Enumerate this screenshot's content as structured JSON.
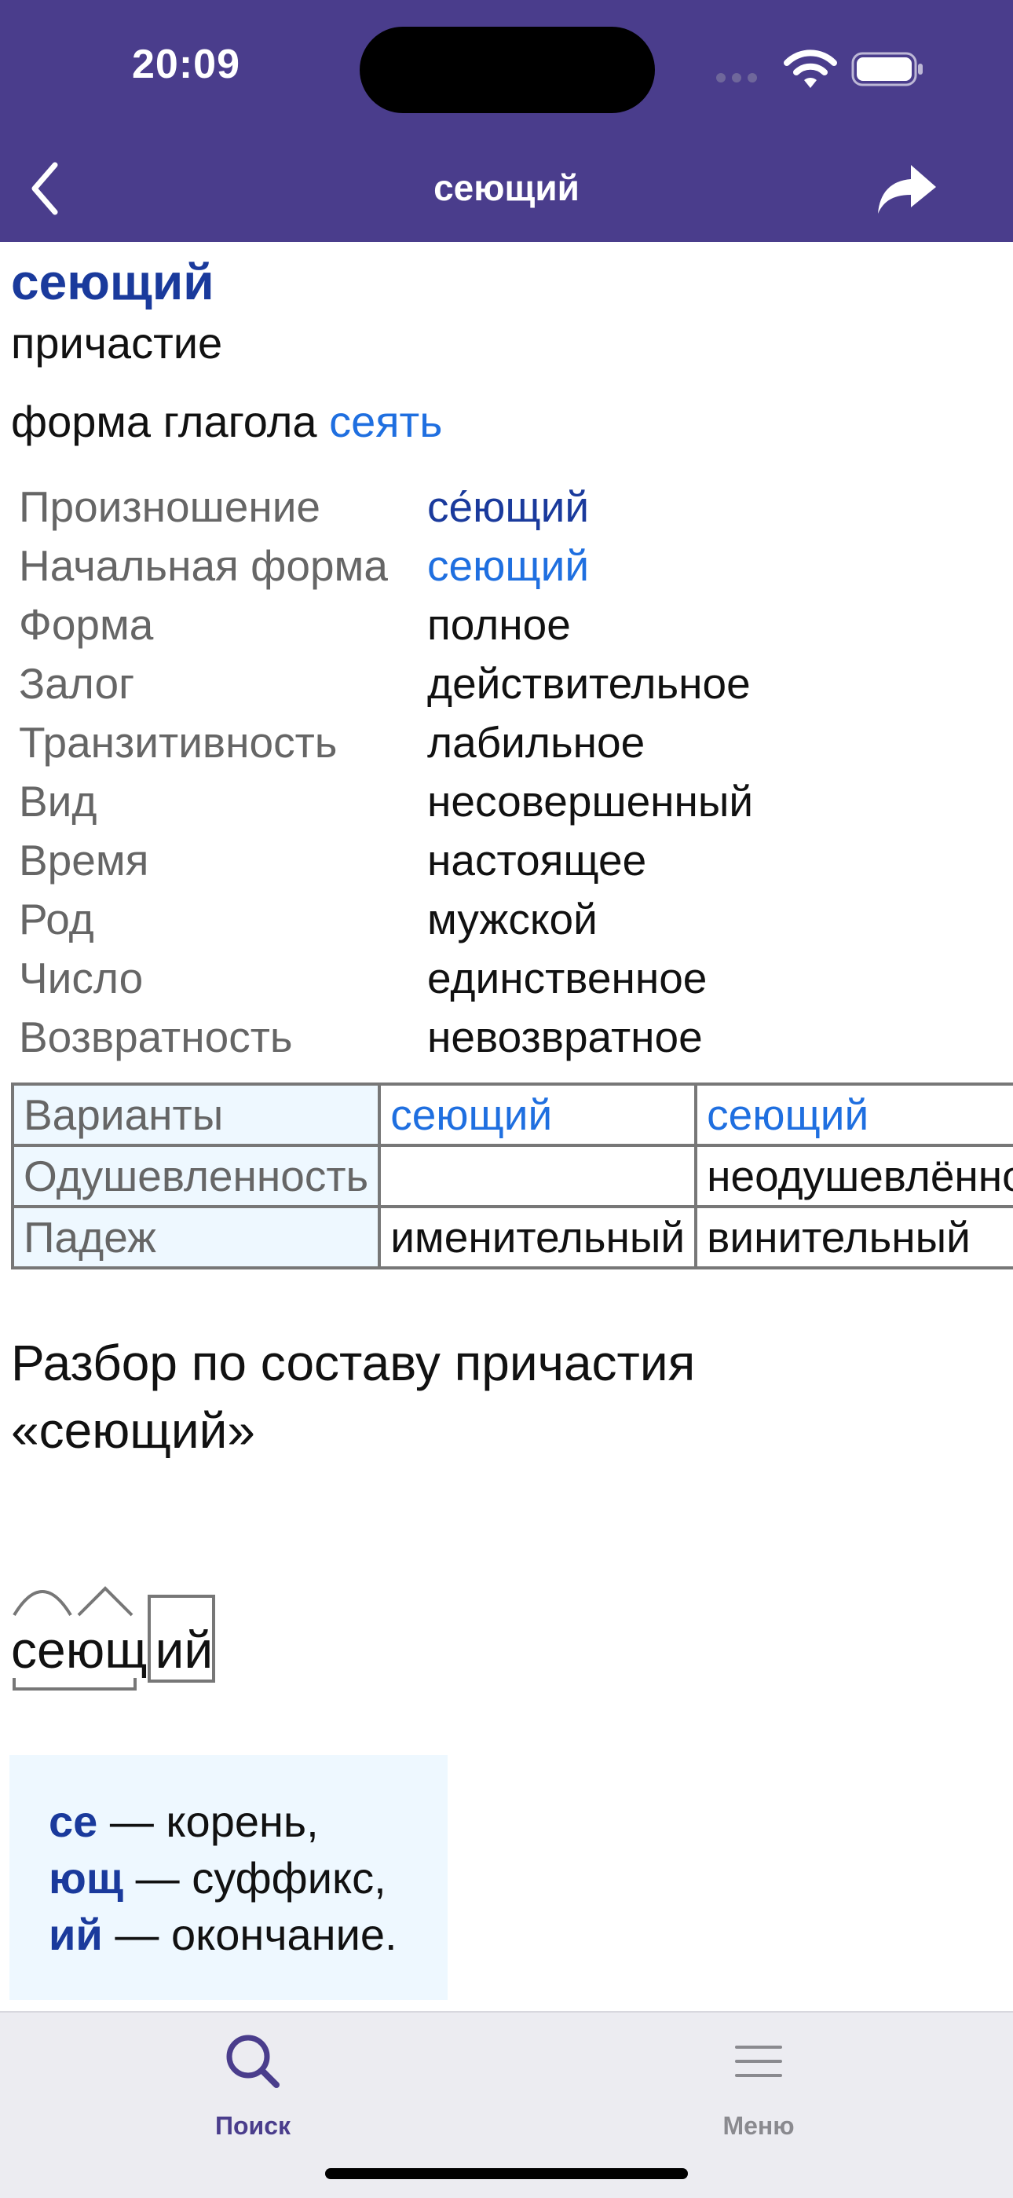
{
  "status_bar": {
    "time": "20:09"
  },
  "nav": {
    "title": "сеющий",
    "back_icon": "chevron-left-icon",
    "share_icon": "share-arrow-icon"
  },
  "entry": {
    "word": "сеющий",
    "part_of_speech": "причастие",
    "form_of_prefix": "форма глагола",
    "form_of_link": "сеять"
  },
  "properties": [
    {
      "key": "Произношение",
      "value": "се́ющий",
      "style": "dark"
    },
    {
      "key": "Начальная форма",
      "value": "сеющий",
      "style": "link"
    },
    {
      "key": "Форма",
      "value": "полное",
      "style": "plain"
    },
    {
      "key": "Залог",
      "value": "действительное",
      "style": "plain"
    },
    {
      "key": "Транзитивность",
      "value": "лабильное",
      "style": "plain"
    },
    {
      "key": "Вид",
      "value": "несовершенный",
      "style": "plain"
    },
    {
      "key": "Время",
      "value": "настоящее",
      "style": "plain"
    },
    {
      "key": "Род",
      "value": "мужской",
      "style": "plain"
    },
    {
      "key": "Число",
      "value": "единственное",
      "style": "plain"
    },
    {
      "key": "Возвратность",
      "value": "невозвратное",
      "style": "plain"
    }
  ],
  "variants_table": {
    "rows": [
      {
        "header": "Варианты",
        "cells": [
          "сеющий",
          "сеющий"
        ]
      },
      {
        "header": "Одушевленность",
        "cells": [
          "",
          "неодушевлённое"
        ]
      },
      {
        "header": "Падеж",
        "cells": [
          "именительный",
          "винительный"
        ]
      }
    ]
  },
  "morphology": {
    "heading": "Разбор по составу причастия «сеющий»",
    "word_parts": {
      "root": "се",
      "suffix": "ющ",
      "ending": "ий"
    },
    "legend": [
      {
        "part": "се",
        "desc": "— корень,"
      },
      {
        "part": "ющ",
        "desc": "— суффикс,"
      },
      {
        "part": "ий",
        "desc": "— окончание."
      }
    ]
  },
  "tab_bar": {
    "search": {
      "label": "Поиск",
      "icon": "search-icon",
      "active": true
    },
    "menu": {
      "label": "Меню",
      "icon": "menu-icon",
      "active": false
    }
  },
  "colors": {
    "header_bg": "#4a3d8c",
    "link": "#1f6fe0",
    "dark_link": "#1a3a9c",
    "table_header_bg": "#eef8ff"
  }
}
